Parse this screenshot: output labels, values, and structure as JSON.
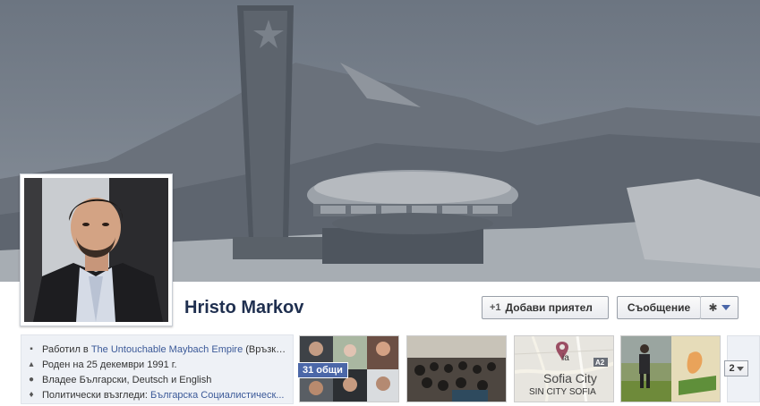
{
  "profile": {
    "name": "Hristo Markov"
  },
  "actions": {
    "add_friend_prefix": "+1",
    "add_friend": "Добави приятел",
    "message": "Съобщение"
  },
  "info": [
    {
      "icon": "briefcase-icon",
      "prefix": "Работил в ",
      "link": "The Untouchable Maybach Empire",
      "suffix": " (Връзки ..."
    },
    {
      "icon": "birthday-icon",
      "prefix": "Роден на 25 декември 1991 г.",
      "link": "",
      "suffix": ""
    },
    {
      "icon": "globe-icon",
      "prefix": "Владее Български, Deutsch и English",
      "link": "",
      "suffix": ""
    },
    {
      "icon": "podium-icon",
      "prefix": "Политически възгледи: ",
      "link": "Българска Социалистическ...",
      "suffix": ""
    }
  ],
  "friends": {
    "badge": "31 общи"
  },
  "map": {
    "city": "Sofia City",
    "caption": "SIN CITY SOFIA",
    "road": "A2",
    "pin_label": "ia"
  },
  "more": {
    "count": "2"
  }
}
